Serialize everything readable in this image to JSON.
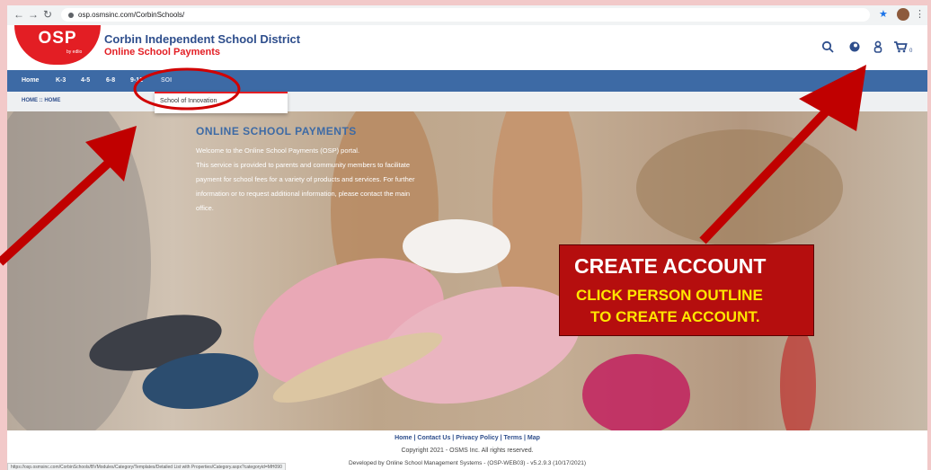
{
  "browser": {
    "url": "osp.osmsinc.com/CorbinSchools/",
    "status_url": "https://osp.osmsinc.com/CorbinSchools/BVModules/Category/Templates/Detailed List with Properties/Category.aspx?categoryid=MH090"
  },
  "header": {
    "logo_text": "OSP",
    "logo_sub": "by edlio",
    "district": "Corbin Independent School District",
    "subtitle": "Online School Payments",
    "cart_count": "0"
  },
  "nav": {
    "items": [
      {
        "label": "Home"
      },
      {
        "label": "K-3"
      },
      {
        "label": "4-5"
      },
      {
        "label": "6-8"
      },
      {
        "label": "9-12"
      },
      {
        "label": "SOI"
      }
    ],
    "dropdown_item": "School of Innovation"
  },
  "breadcrumb": "HOME :: HOME",
  "hero": {
    "title": "ONLINE SCHOOL PAYMENTS",
    "lines": [
      "Welcome to the Online School Payments (OSP) portal.",
      "This service is provided to parents and community members to facilitate",
      "payment for school fees for a variety of products and services. For further",
      "information or to request additional information, please contact the main",
      "office."
    ]
  },
  "callout": {
    "title": "CREATE ACCOUNT",
    "line1": "CLICK PERSON OUTLINE",
    "line2": "TO CREATE ACCOUNT."
  },
  "footer": {
    "links": [
      "Home",
      "Contact Us",
      "Privacy Policy",
      "Terms",
      "Map"
    ],
    "separator": " | ",
    "copyright": "Copyright 2021 - OSMS Inc. All rights reserved.",
    "developed": "Developed by Online School Management Systems - (OSP-WEB03) - v5.2.9.3 (10/17/2021)"
  },
  "colors": {
    "brand_red": "#e31e24",
    "brand_blue": "#2e4e8c",
    "nav_blue": "#3d6aa5",
    "callout_red": "#b50e0e",
    "callout_yellow": "#ffe600"
  },
  "icons": [
    "search-icon",
    "location-icon",
    "user-icon",
    "cart-icon"
  ]
}
